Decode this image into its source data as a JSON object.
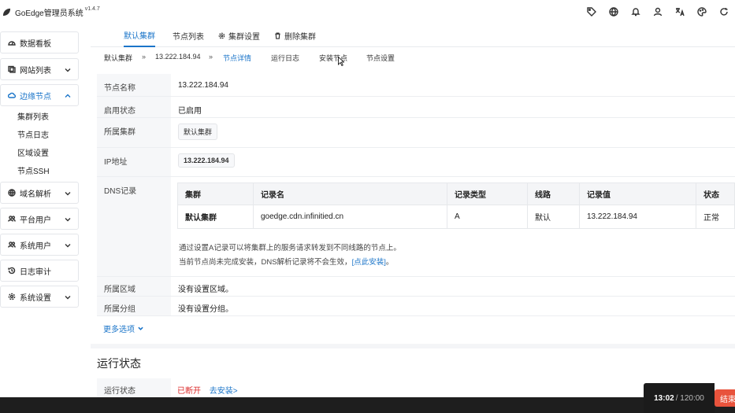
{
  "app": {
    "title": "GoEdge管理员系统",
    "version": "v1.4.7"
  },
  "top_icons": [
    "tag-icon",
    "globe-icon",
    "bell-icon",
    "user-icon",
    "translate-icon",
    "palette-icon",
    "refresh-icon"
  ],
  "sidebar": {
    "items": [
      {
        "label": "数据看板",
        "icon": "dashboard-icon"
      },
      {
        "label": "网站列表",
        "icon": "website-icon"
      },
      {
        "label": "边缘节点",
        "icon": "cloud-icon"
      },
      {
        "label": "域名解析",
        "icon": "globe-icon"
      },
      {
        "label": "平台用户",
        "icon": "users-icon"
      },
      {
        "label": "系统用户",
        "icon": "users-icon"
      },
      {
        "label": "日志审计",
        "icon": "history-icon"
      },
      {
        "label": "系统设置",
        "icon": "gear-icon"
      }
    ],
    "sub_items": [
      "集群列表",
      "节点日志",
      "区域设置",
      "节点SSH"
    ]
  },
  "tabs": [
    {
      "label": "默认集群"
    },
    {
      "label": "节点列表"
    },
    {
      "label": "集群设置"
    },
    {
      "label": "删除集群"
    }
  ],
  "breadcrumbs": {
    "cluster": "默认集群",
    "node": "13.222.184.94",
    "items": [
      "节点详情",
      "运行日志",
      "安装节点",
      "节点设置"
    ]
  },
  "details": {
    "node_name": {
      "label": "节点名称",
      "value": "13.222.184.94"
    },
    "enabled": {
      "label": "启用状态",
      "value": "已启用"
    },
    "cluster": {
      "label": "所属集群",
      "value": "默认集群"
    },
    "ip": {
      "label": "IP地址",
      "value": "13.222.184.94"
    },
    "dns": {
      "label": "DNS记录",
      "headers": [
        "集群",
        "记录名",
        "记录类型",
        "线路",
        "记录值",
        "状态"
      ],
      "rows": [
        [
          "默认集群",
          "goedge.cdn.infinitied.cn",
          "A",
          "默认",
          "13.222.184.94",
          "正常"
        ]
      ],
      "note1": "通过设置A记录可以将集群上的服务请求转发到不同线路的节点上。",
      "note2_prefix": "当前节点尚未完成安装，DNS解析记录将不会生效，",
      "note2_link": "[点此安装]",
      "note2_suffix": "。"
    },
    "region": {
      "label": "所属区域",
      "value": "没有设置区域。"
    },
    "group": {
      "label": "所属分组",
      "value": "没有设置分组。"
    }
  },
  "more_options": "更多选项",
  "runtime": {
    "title": "运行状态",
    "status_label": "运行状态",
    "status_value": "已断开",
    "install_link": "去安装>"
  },
  "timer": {
    "elapsed": "13:02",
    "total": "/ 120:00",
    "end_label": "结束"
  }
}
